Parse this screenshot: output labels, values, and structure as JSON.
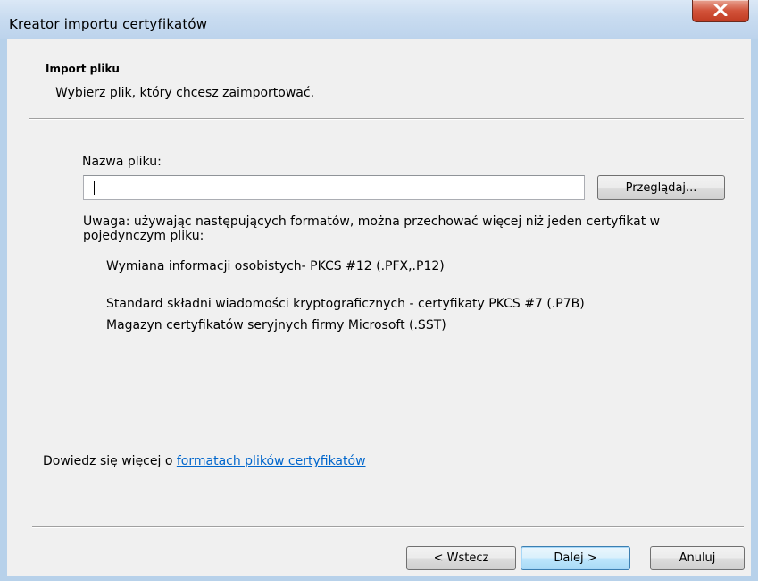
{
  "window": {
    "title": "Kreator importu certyfikatów"
  },
  "header": {
    "title": "Import pliku",
    "subtitle": "Wybierz plik, który chcesz zaimportować."
  },
  "file": {
    "label": "Nazwa pliku:",
    "value": "",
    "browse_label": "Przeglądaj..."
  },
  "note": "Uwaga: używając następujących formatów, można przechować więcej niż jeden certyfikat w pojedynczym pliku:",
  "formats": [
    "Wymiana informacji osobistych- PKCS #12 (.PFX,.P12)",
    "Standard składni wiadomości kryptograficznych - certyfikaty PKCS #7 (.P7B)",
    "Magazyn certyfikatów seryjnych firmy Microsoft (.SST)"
  ],
  "learn_more": {
    "prefix": "Dowiedz się więcej o ",
    "link_text": "formatach plików certyfikatów"
  },
  "buttons": {
    "back": "< Wstecz",
    "next": "Dalej >",
    "cancel": "Anuluj"
  },
  "colors": {
    "link": "#0066cc",
    "close": "#c13b22",
    "frame": "#b7d1ea"
  },
  "icons": {
    "close": "close-x-icon"
  }
}
